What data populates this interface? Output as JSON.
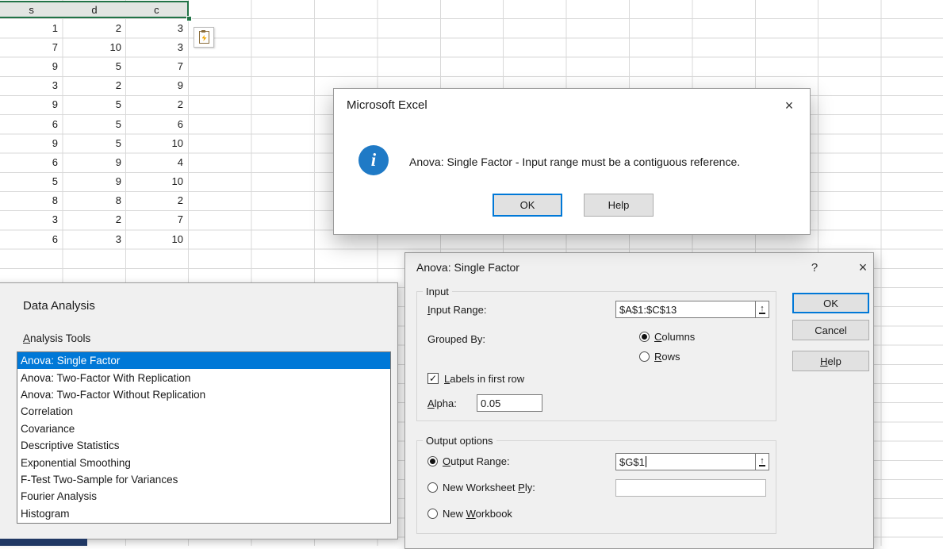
{
  "colors": {
    "accent_blue": "#0078d7",
    "selection_green": "#217346",
    "dialog_bg": "#f0f0f0",
    "grid_line": "#d9d9d9",
    "list_selection_bg": "#0078d7",
    "info_icon_bg": "#1f7ac6",
    "bottom_bar": "#203864"
  },
  "icons": {
    "close": "×",
    "help": "?",
    "info": "i",
    "range_picker": "↑",
    "checkmark": "✓"
  },
  "spreadsheet": {
    "column_headers": [
      "s",
      "d",
      "c"
    ],
    "rows": [
      [
        1,
        2,
        3
      ],
      [
        7,
        10,
        3
      ],
      [
        9,
        5,
        7
      ],
      [
        3,
        2,
        9
      ],
      [
        9,
        5,
        2
      ],
      [
        6,
        5,
        6
      ],
      [
        9,
        5,
        10
      ],
      [
        6,
        9,
        4
      ],
      [
        5,
        9,
        10
      ],
      [
        8,
        8,
        2
      ],
      [
        3,
        2,
        7
      ],
      [
        6,
        3,
        10
      ]
    ]
  },
  "alert_dialog": {
    "title": "Microsoft Excel",
    "message": "Anova: Single Factor - Input range must be a contiguous reference.",
    "ok_label": "OK",
    "help_label": "Help"
  },
  "anova_dialog": {
    "title": "Anova: Single Factor",
    "input": {
      "legend": "Input",
      "input_range_label": "Input Range:",
      "input_range_value": "$A$1:$C$13",
      "grouped_by_label": "Grouped By:",
      "columns_label": "Columns",
      "rows_label": "Rows",
      "grouped_by_selected": "Columns",
      "labels_label": "Labels in first row",
      "labels_checked": true,
      "alpha_label": "Alpha:",
      "alpha_value": "0.05"
    },
    "output": {
      "legend": "Output options",
      "output_range_label": "Output Range:",
      "output_range_value": "$G$1",
      "new_worksheet_label": "New Worksheet Ply:",
      "new_worksheet_value": "",
      "new_workbook_label": "New Workbook",
      "selected": "Output Range"
    },
    "buttons": {
      "ok": "OK",
      "cancel": "Cancel",
      "help": "Help"
    }
  },
  "data_analysis_dialog": {
    "title": "Data Analysis",
    "list_label": "Analysis Tools",
    "selected_tool": "Anova: Single Factor",
    "tools": [
      "Anova: Single Factor",
      "Anova: Two-Factor With Replication",
      "Anova: Two-Factor Without Replication",
      "Correlation",
      "Covariance",
      "Descriptive Statistics",
      "Exponential Smoothing",
      "F-Test Two-Sample for Variances",
      "Fourier Analysis",
      "Histogram"
    ]
  }
}
